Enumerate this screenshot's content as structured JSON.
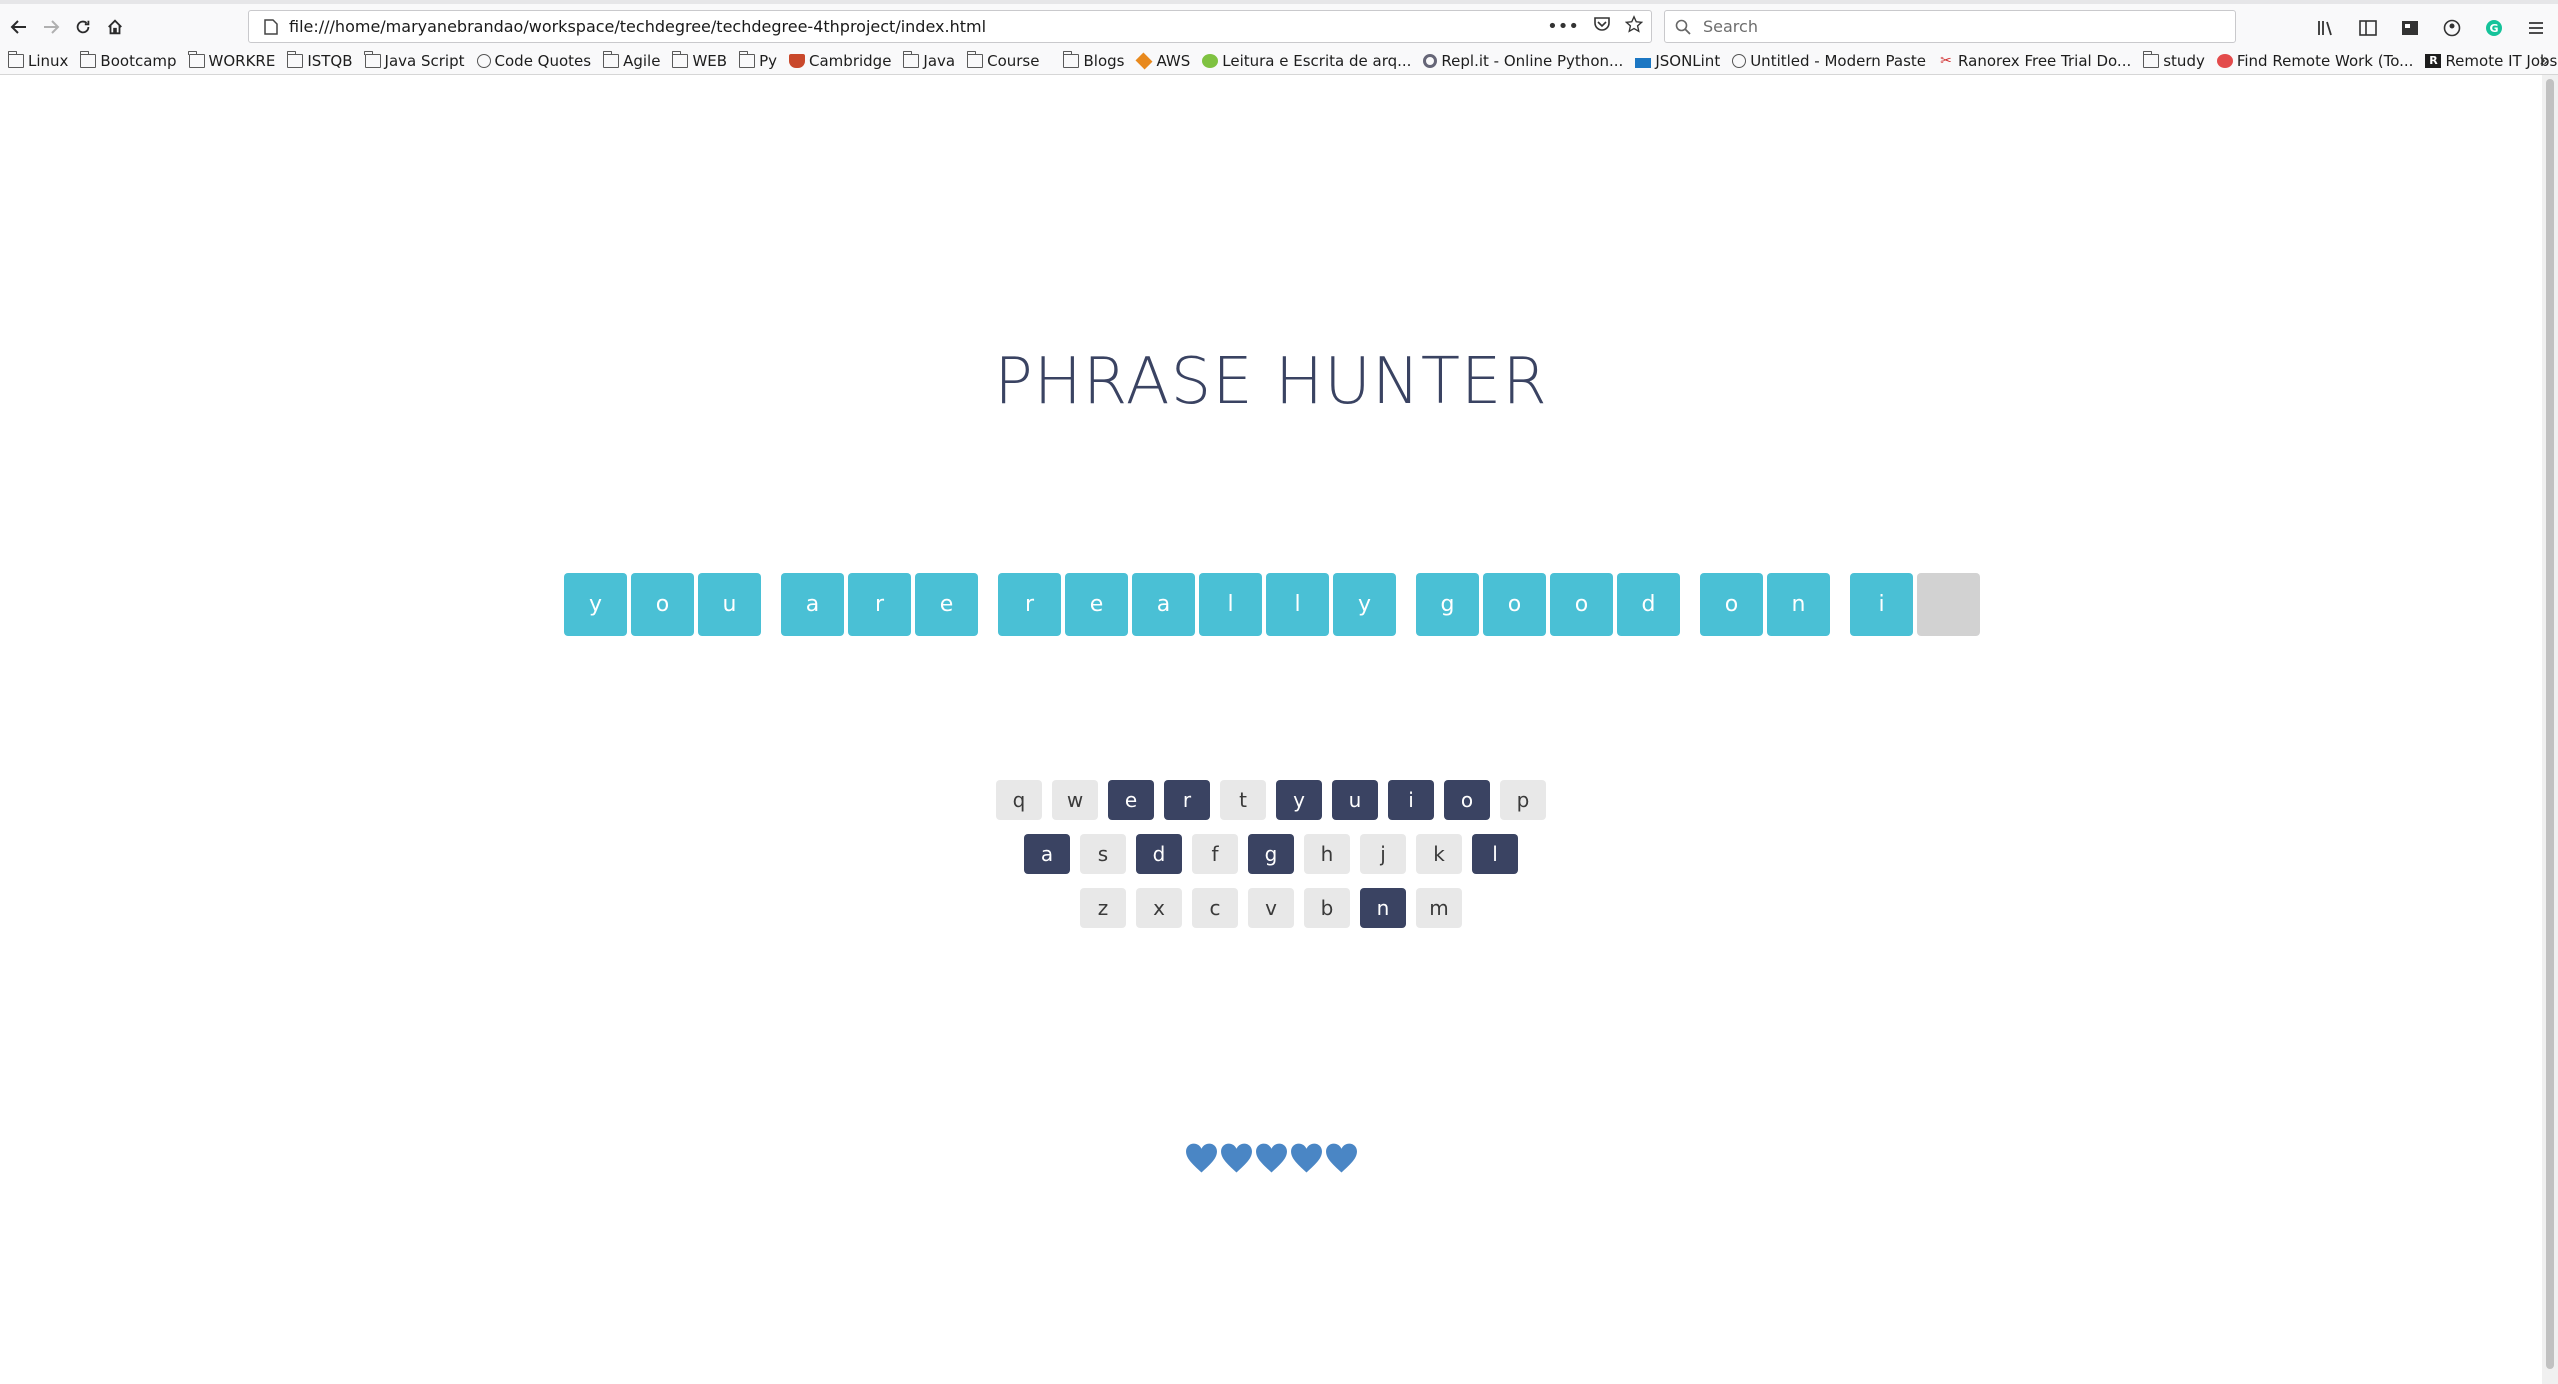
{
  "browser": {
    "url": "file:///home/maryanebrandao/workspace/techdegree/techdegree-4thproject/index.html",
    "search_placeholder": "Search",
    "bookmarks": [
      {
        "label": "Linux",
        "icon": "folder"
      },
      {
        "label": "Bootcamp",
        "icon": "folder"
      },
      {
        "label": "WORKRE",
        "icon": "folder"
      },
      {
        "label": "ISTQB",
        "icon": "folder"
      },
      {
        "label": "Java Script",
        "icon": "folder"
      },
      {
        "label": "Code Quotes",
        "icon": "globe"
      },
      {
        "label": "Agile",
        "icon": "folder"
      },
      {
        "label": "WEB",
        "icon": "folder"
      },
      {
        "label": "Py",
        "icon": "folder"
      },
      {
        "label": "Cambridge",
        "icon": "shield"
      },
      {
        "label": "Java",
        "icon": "folder"
      },
      {
        "label": "Course",
        "icon": "folder"
      },
      {
        "label": "|",
        "icon": "separator"
      },
      {
        "label": "Blogs",
        "icon": "folder"
      },
      {
        "label": "AWS",
        "icon": "box"
      },
      {
        "label": "Leitura e Escrita de arq...",
        "icon": "green"
      },
      {
        "label": "Repl.it - Online Python...",
        "icon": "repl"
      },
      {
        "label": "JSONLint",
        "icon": "json"
      },
      {
        "label": "Untitled - Modern Paste",
        "icon": "globe"
      },
      {
        "label": "Ranorex Free Trial Do...",
        "icon": "ranorex"
      },
      {
        "label": "study",
        "icon": "folder"
      },
      {
        "label": "Find Remote Work (To...",
        "icon": "red"
      },
      {
        "label": "Remote IT Jobs - Rem...",
        "icon": "r"
      }
    ]
  },
  "game": {
    "title": "PHRASE HUNTER",
    "phrase_letters": [
      "y",
      "o",
      "u",
      " ",
      "a",
      "r",
      "e",
      " ",
      "r",
      "e",
      "a",
      "l",
      "l",
      "y",
      " ",
      "g",
      "o",
      "o",
      "d",
      " ",
      "o",
      "n",
      " ",
      "i",
      "?"
    ],
    "keyboard_rows": [
      [
        "q",
        "w",
        "e",
        "r",
        "t",
        "y",
        "u",
        "i",
        "o",
        "p"
      ],
      [
        "a",
        "s",
        "d",
        "f",
        "g",
        "h",
        "j",
        "k",
        "l"
      ],
      [
        "z",
        "x",
        "c",
        "v",
        "b",
        "n",
        "m"
      ]
    ],
    "chosen_keys": [
      "e",
      "r",
      "y",
      "u",
      "i",
      "o",
      "a",
      "d",
      "g",
      "l",
      "n"
    ],
    "lives_remaining": 5,
    "colors": {
      "title": "#3a4362",
      "revealed_tile": "#4ac0d5",
      "hidden_tile": "#d2d2d2",
      "key_default": "#e8e8e8",
      "key_chosen": "#3a4362",
      "heart": "#4a86c5"
    }
  }
}
